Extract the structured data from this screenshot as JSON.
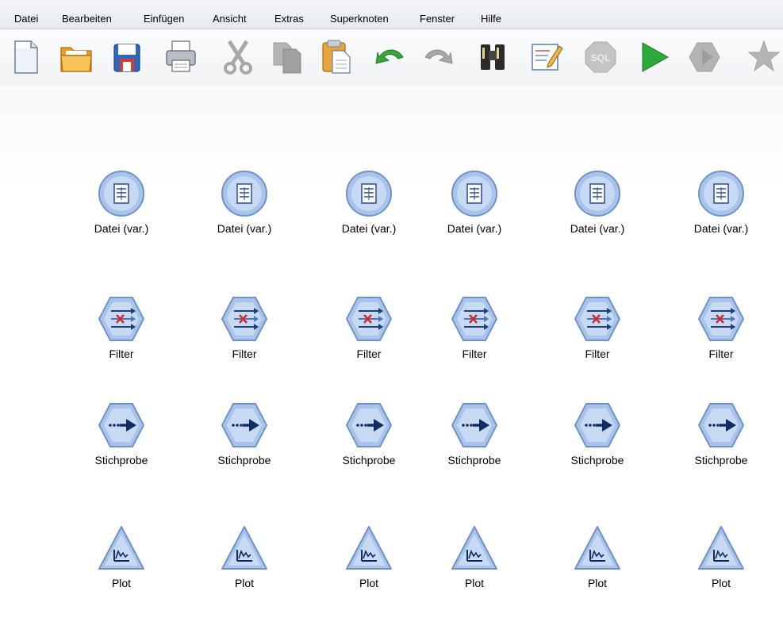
{
  "menu": {
    "items": [
      "Datei",
      "Bearbeiten",
      "Einfügen",
      "Ansicht",
      "Extras",
      "Superknoten",
      "Fenster",
      "Hilfe"
    ]
  },
  "toolbar": {
    "buttons": [
      {
        "icon": "new-document-icon",
        "enabled": true
      },
      {
        "icon": "open-folder-icon",
        "enabled": true
      },
      {
        "icon": "save-icon",
        "enabled": true
      },
      {
        "icon": "print-icon",
        "enabled": true
      },
      {
        "icon": "cut-icon",
        "enabled": false
      },
      {
        "icon": "copy-icon",
        "enabled": false
      },
      {
        "icon": "paste-icon",
        "enabled": true
      },
      {
        "icon": "undo-icon",
        "enabled": true
      },
      {
        "icon": "redo-icon",
        "enabled": false
      },
      {
        "icon": "binoculars-icon",
        "enabled": true
      },
      {
        "icon": "edit-icon",
        "enabled": true
      },
      {
        "icon": "sql-icon",
        "enabled": false,
        "text": "SQL"
      },
      {
        "icon": "run-icon",
        "enabled": true
      },
      {
        "icon": "run-selection-icon",
        "enabled": false
      },
      {
        "icon": "star-icon",
        "enabled": false
      }
    ]
  },
  "canvas": {
    "rows": [
      {
        "node_type": "datei",
        "label": "Datei (var.)",
        "count": 6
      },
      {
        "node_type": "filter",
        "label": "Filter",
        "count": 6
      },
      {
        "node_type": "stichprobe",
        "label": "Stichprobe",
        "count": 6
      },
      {
        "node_type": "plot",
        "label": "Plot",
        "count": 6
      }
    ]
  },
  "colors": {
    "node_fill": "#a9c4ea",
    "node_stroke": "#6f93c9",
    "run_green": "#2fa83a",
    "disabled_gray": "#a8a8a8"
  }
}
